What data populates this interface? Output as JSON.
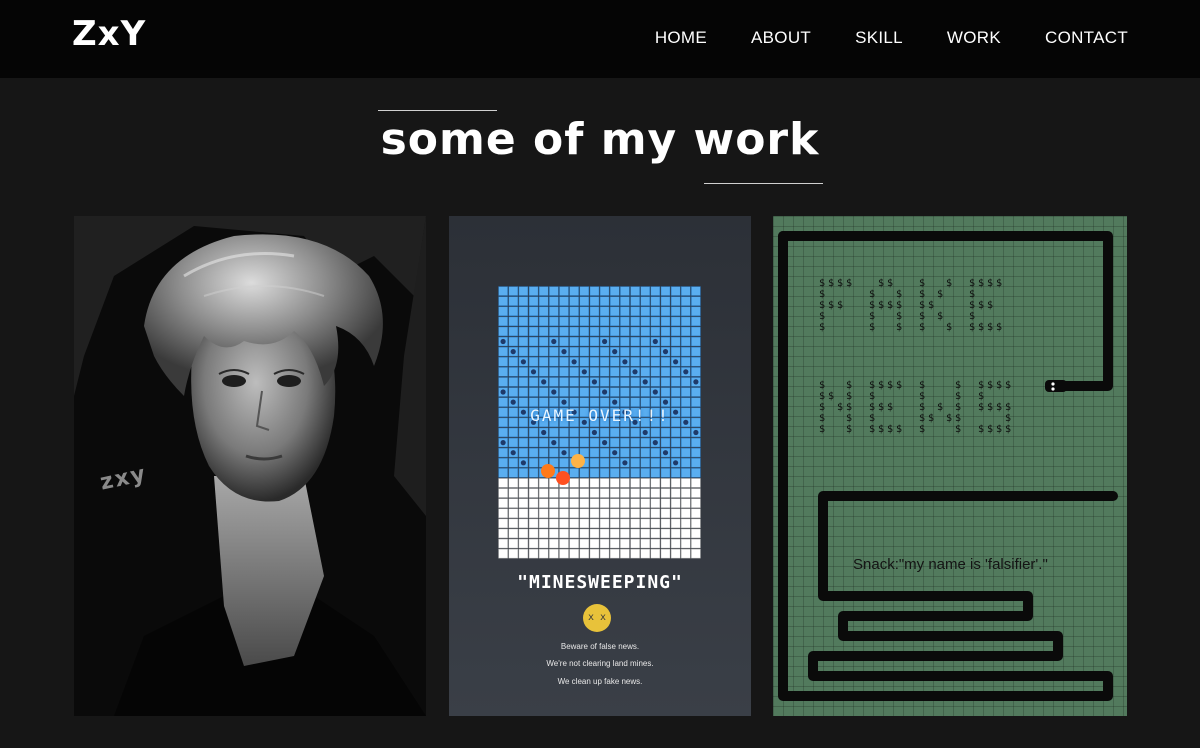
{
  "brand": {
    "logo": "ZxY"
  },
  "nav": {
    "items": [
      "HOME",
      "ABOUT",
      "SKILL",
      "WORK",
      "CONTACT"
    ]
  },
  "section": {
    "title": "some of my work"
  },
  "works": {
    "portrait": {
      "signature": "zxy"
    },
    "minesweeping": {
      "overlay_text": "GAME OVER!!!",
      "title": "\"MINESWEEPING\"",
      "face": "x x",
      "lines": [
        "Beware of false news.",
        "We're not clearing land mines.",
        "We clean up fake news."
      ]
    },
    "fake_news": {
      "words": [
        "FAKE",
        "NEWS"
      ],
      "fill_glyph": "$",
      "quote": "Snack:\"my name is 'falsifier'.\""
    }
  },
  "colors": {
    "page_bg": "#161616",
    "header_bg": "#050505",
    "snake_bg": "#527a5d",
    "mine_blue": "#5aaef0",
    "mine_white": "#ffffff"
  }
}
